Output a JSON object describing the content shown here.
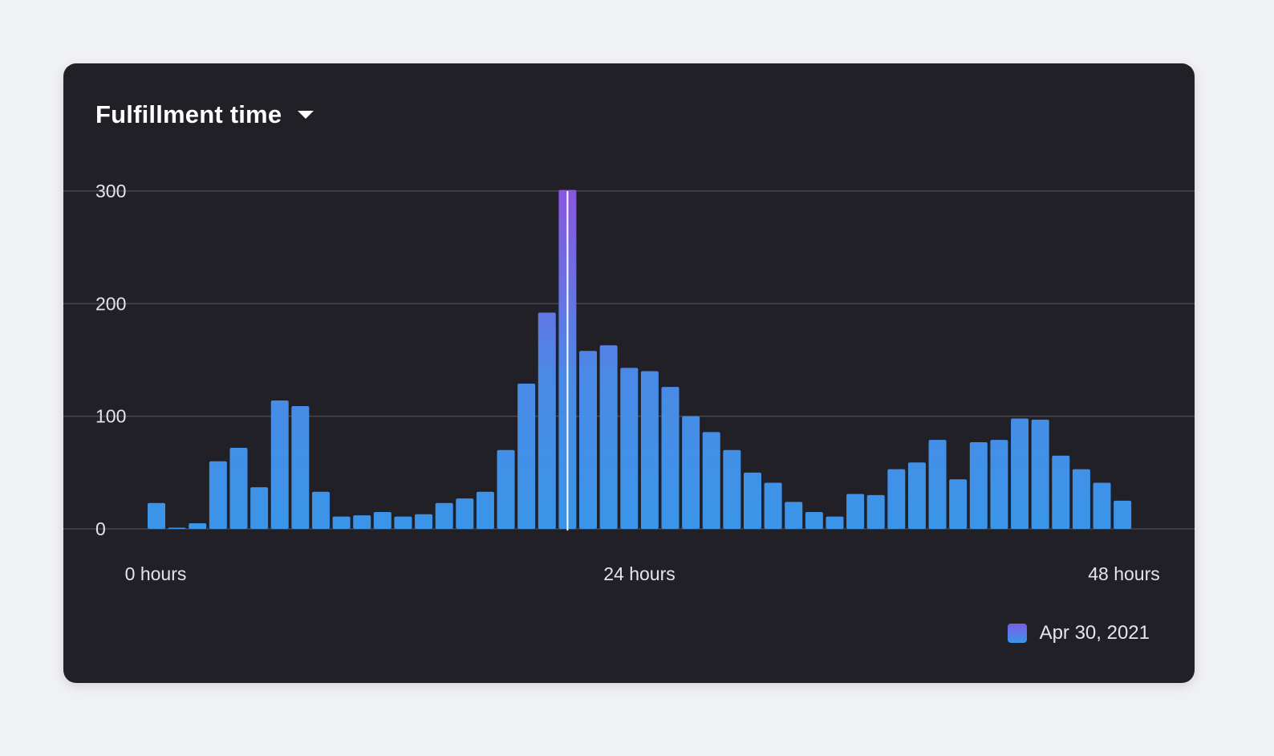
{
  "chart_data": {
    "type": "bar",
    "title": "Fulfillment time",
    "ylim": [
      0,
      300
    ],
    "y_ticks": [
      "0",
      "100",
      "200",
      "300"
    ],
    "x_tick_labels": [
      "0 hours",
      "24 hours",
      "48 hours"
    ],
    "grid": true,
    "legend_position": "bottom-right",
    "highlighted_index": 20,
    "series": [
      {
        "name": "Apr 30, 2021",
        "values": [
          23,
          1,
          5,
          60,
          72,
          37,
          114,
          109,
          33,
          11,
          12,
          15,
          11,
          13,
          23,
          27,
          33,
          70,
          129,
          192,
          301,
          158,
          163,
          143,
          140,
          126,
          100,
          86,
          70,
          50,
          41,
          24,
          15,
          11,
          31,
          30,
          53,
          59,
          79,
          44,
          77,
          79,
          98,
          97,
          65,
          53,
          41,
          25
        ]
      }
    ]
  },
  "colors": {
    "background": "#f0f1f3",
    "card": "#202026",
    "gridline": "#45454c",
    "bar_bottom": "#3a95e8",
    "bar_top": "#8a56e2",
    "highlight_line": "#ffffff",
    "text": "#e4e4ea"
  },
  "icons": {
    "dropdown": "caret-down-icon"
  }
}
